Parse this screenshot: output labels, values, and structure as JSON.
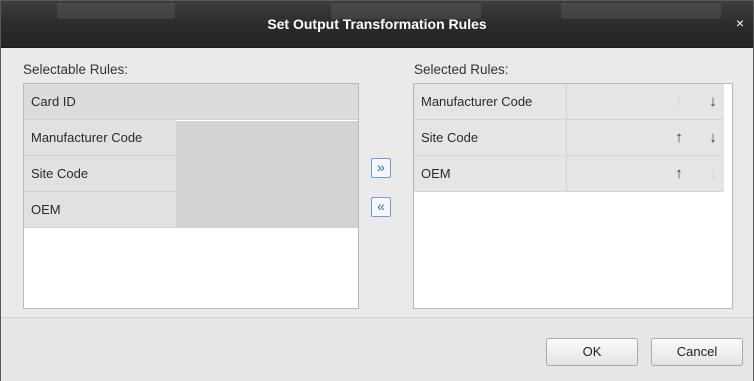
{
  "dialog": {
    "title": "Set Output Transformation Rules",
    "close_glyph": "×"
  },
  "selectable": {
    "label": "Selectable Rules:",
    "items": [
      "Card ID",
      "Manufacturer Code",
      "Site Code",
      "OEM"
    ]
  },
  "selected": {
    "label": "Selected Rules:",
    "items": [
      "Manufacturer Code",
      "Site Code",
      "OEM"
    ]
  },
  "move": {
    "add_glyph": "»",
    "remove_glyph": "«"
  },
  "footer": {
    "ok_label": "OK",
    "cancel_label": "Cancel"
  },
  "icons": {
    "up": "↑",
    "down": "↓"
  },
  "colors": {
    "titlebar": "#2b2b2b",
    "accent": "#2c6fb6"
  }
}
